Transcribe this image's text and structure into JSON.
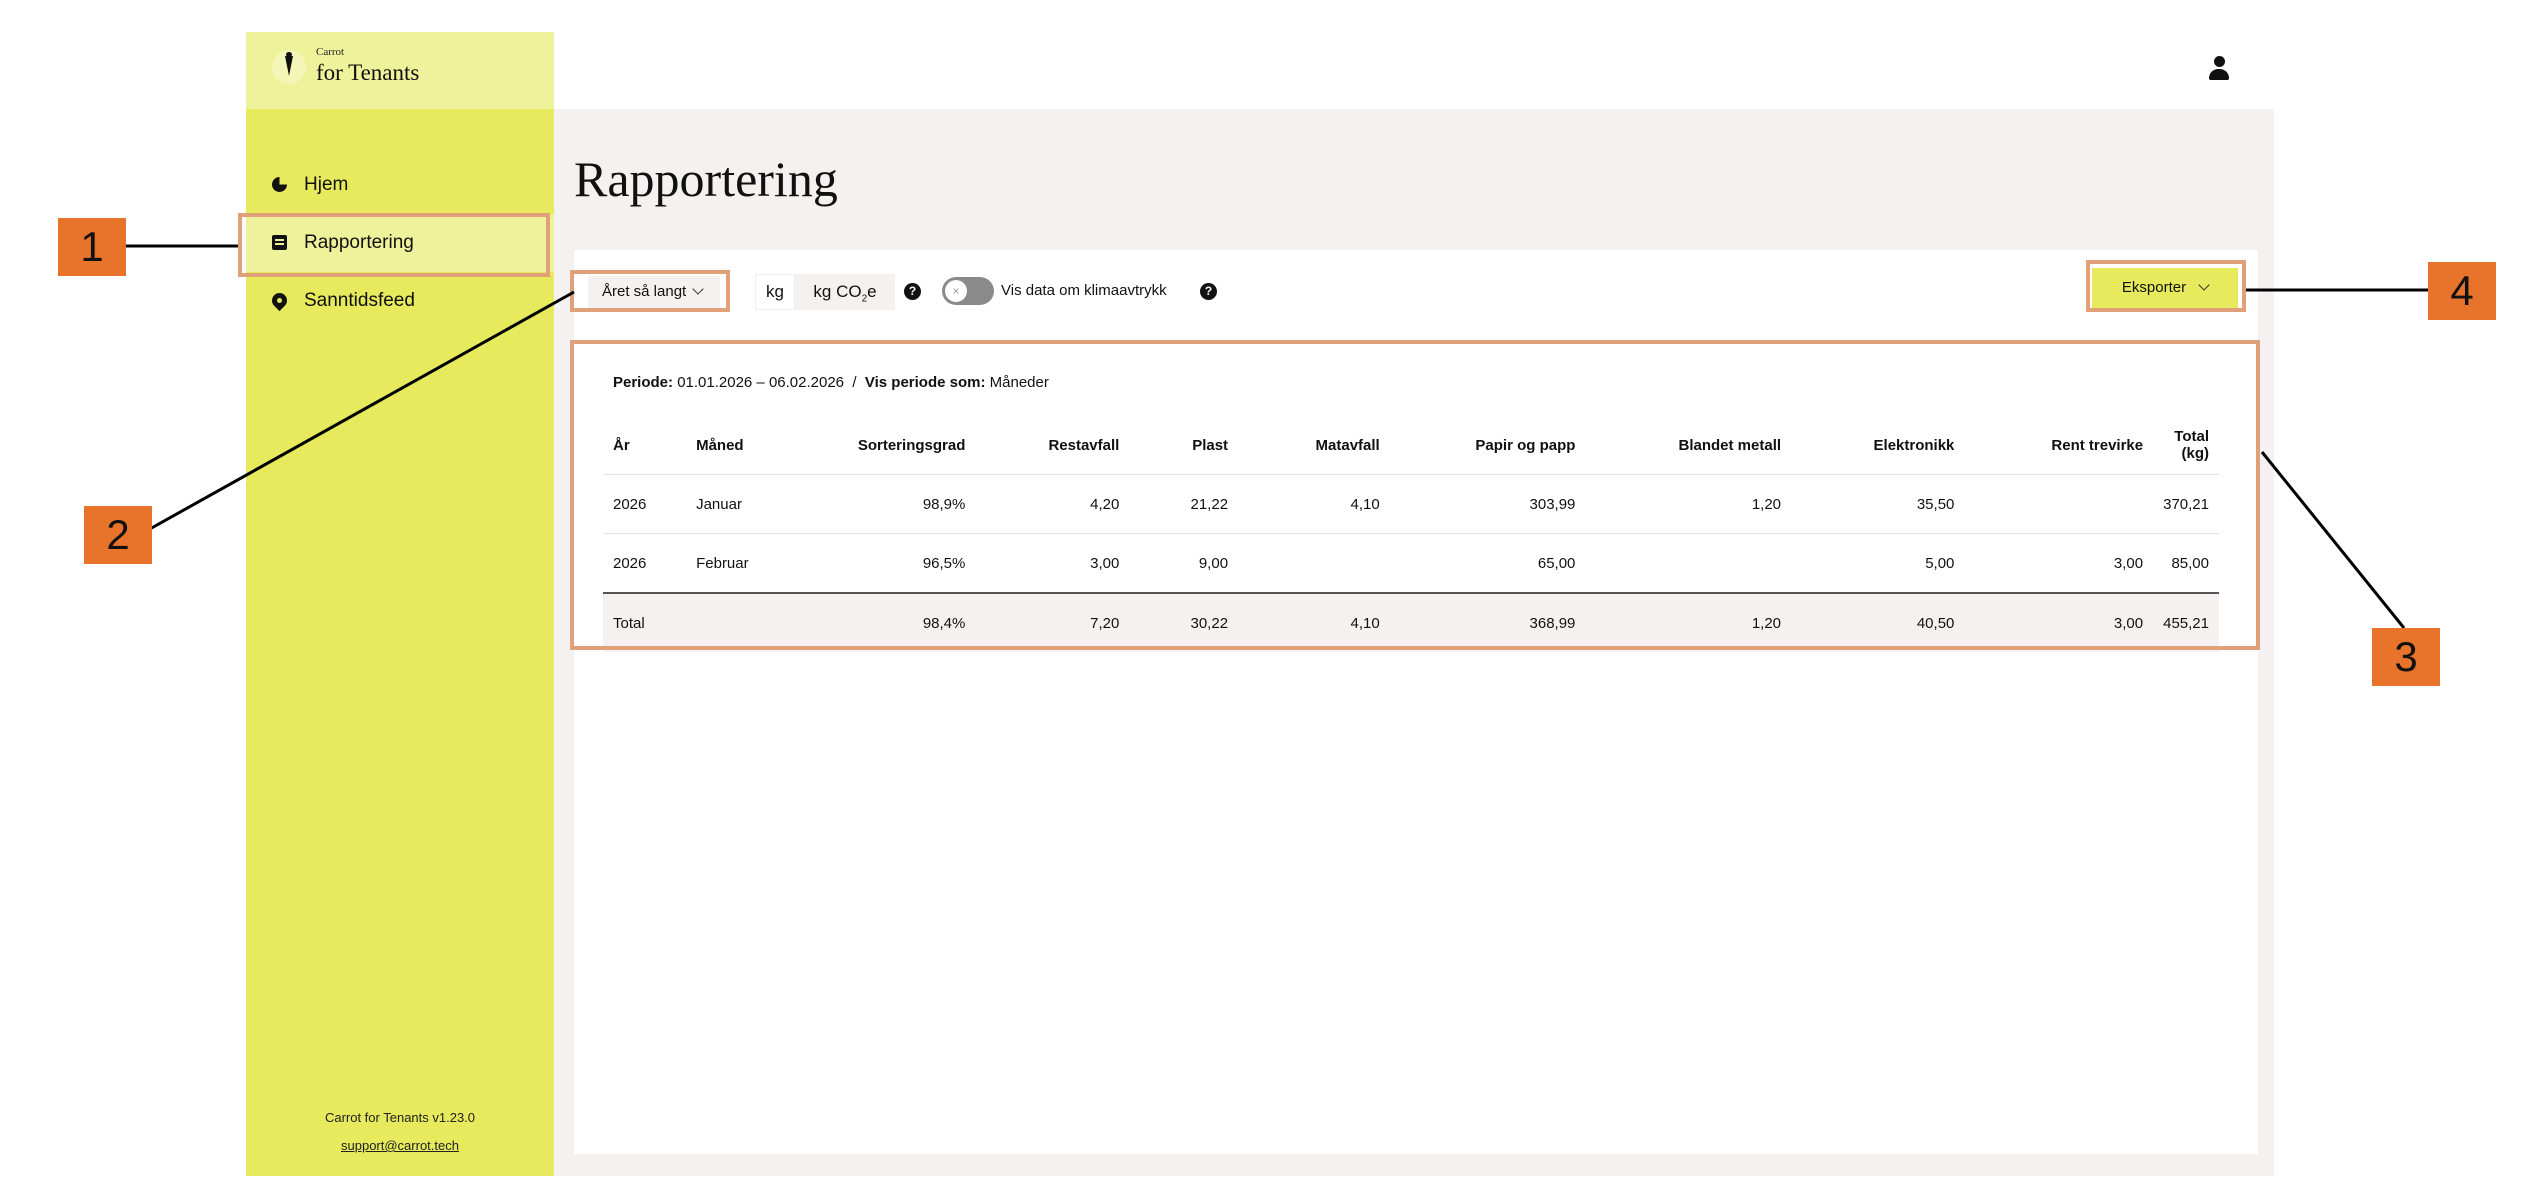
{
  "app": {
    "logo_small": "Carrot",
    "logo_big": "for Tenants"
  },
  "sidebar": {
    "items": [
      {
        "label": "Hjem",
        "icon": "pie-chart-icon"
      },
      {
        "label": "Rapportering",
        "icon": "document-icon",
        "active": true
      },
      {
        "label": "Sanntidsfeed",
        "icon": "location-pin-icon"
      }
    ],
    "footer_version": "Carrot for Tenants v1.23.0",
    "footer_link": "support@carrot.tech"
  },
  "header": {
    "user_icon": "user-icon"
  },
  "page": {
    "title": "Rapportering"
  },
  "toolbar": {
    "period_value": "Året så langt",
    "unit_kg": "kg",
    "unit_co2_prefix": "kg CO",
    "unit_co2_sub": "2",
    "unit_co2_suffix": "e",
    "help_glyph": "?",
    "toggle_label": "Vis data om klimaavtrykk",
    "toggle_on": false,
    "export_label": "Eksporter"
  },
  "report": {
    "period_label": "Periode:",
    "period_value": "01.01.2026 – 06.02.2026",
    "separator": "/",
    "show_as_label": "Vis periode som:",
    "show_as_value": "Måneder",
    "columns": [
      "År",
      "Måned",
      "Sorteringsgrad",
      "Restavfall",
      "Plast",
      "Matavfall",
      "Papir og papp",
      "Blandet metall",
      "Elektronikk",
      "Rent trevirke",
      "Total (kg)"
    ],
    "rows": [
      [
        "2026",
        "Januar",
        "98,9%",
        "4,20",
        "21,22",
        "4,10",
        "303,99",
        "1,20",
        "35,50",
        "",
        "370,21"
      ],
      [
        "2026",
        "Februar",
        "96,5%",
        "3,00",
        "9,00",
        "",
        "65,00",
        "",
        "5,00",
        "3,00",
        "85,00"
      ]
    ],
    "total_row": [
      "Total",
      "",
      "98,4%",
      "7,20",
      "30,22",
      "4,10",
      "368,99",
      "1,20",
      "40,50",
      "3,00",
      "455,21"
    ]
  },
  "annotations": {
    "badge_1": "1",
    "badge_2": "2",
    "badge_3": "3",
    "badge_4": "4",
    "highlight_color": "#e0a07a",
    "badge_color": "#e8742c"
  },
  "colors": {
    "sidebar": "#e6ea5c",
    "sidebar_active": "#eef29a",
    "background": "#f5f1f1"
  }
}
